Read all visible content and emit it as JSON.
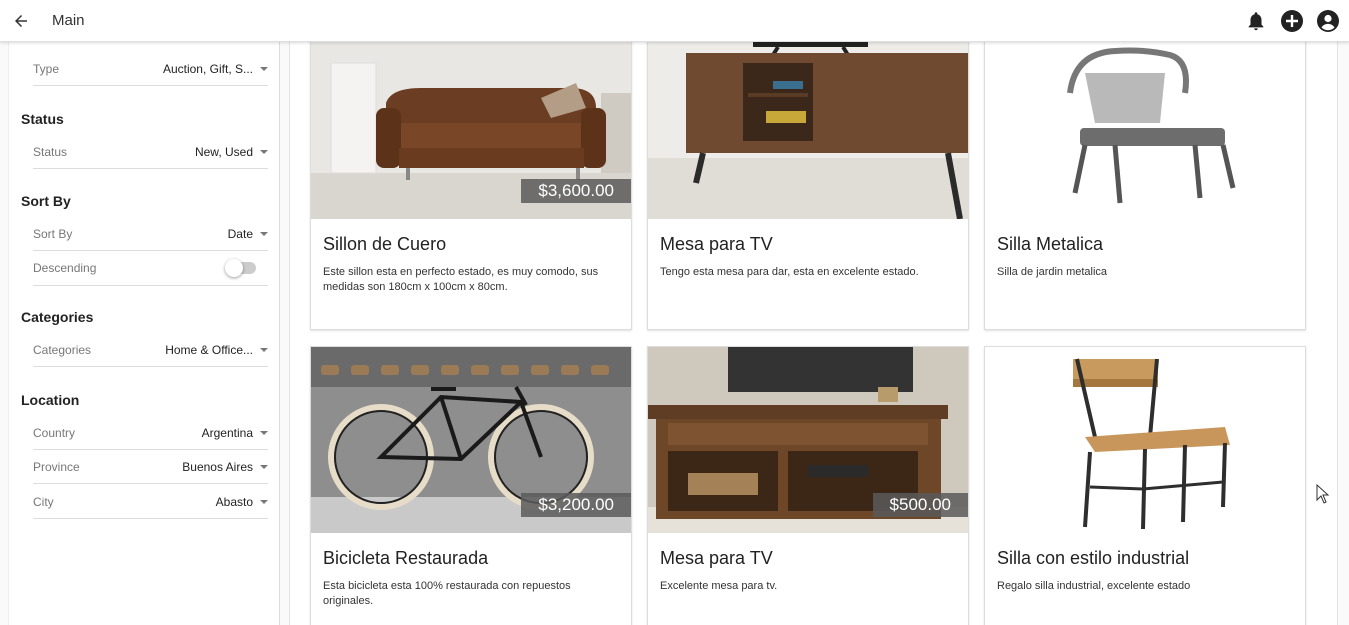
{
  "header": {
    "title": "Main",
    "icons": [
      "back-arrow-icon",
      "bell-icon",
      "add-circle-icon",
      "account-circle-icon"
    ]
  },
  "filters": {
    "type": {
      "label": "Type",
      "value": "Auction, Gift, S..."
    },
    "status": {
      "section": "Status",
      "label": "Status",
      "value": "New, Used"
    },
    "sort": {
      "section": "Sort By",
      "label": "Sort By",
      "value": "Date",
      "descending_label": "Descending",
      "descending": false
    },
    "categories": {
      "section": "Categories",
      "label": "Categories",
      "value": "Home & Office..."
    },
    "location": {
      "section": "Location",
      "country": {
        "label": "Country",
        "value": "Argentina"
      },
      "province": {
        "label": "Province",
        "value": "Buenos Aires"
      },
      "city": {
        "label": "City",
        "value": "Abasto"
      }
    }
  },
  "listings": [
    {
      "title": "Sillon de Cuero",
      "description": "Este sillon esta en perfecto estado, es muy comodo, sus medidas son 180cm x 100cm x 80cm.",
      "price": "$3,600.00",
      "image": "leather-sofa"
    },
    {
      "title": "Mesa para TV",
      "description": "Tengo esta mesa para dar, esta en excelente estado.",
      "price": "",
      "image": "wood-tv-stand"
    },
    {
      "title": "Silla Metalica",
      "description": "Silla de jardin metalica",
      "price": "",
      "image": "metal-chair"
    },
    {
      "title": "Bicicleta Restaurada",
      "description": "Esta bicicleta esta 100% restaurada con repuestos originales.",
      "price": "$3,200.00",
      "image": "bicycle"
    },
    {
      "title": "Mesa para TV",
      "description": "Excelente mesa para tv.",
      "price": "$500.00",
      "image": "rustic-tv-console"
    },
    {
      "title": "Silla con estilo industrial",
      "description": "Regalo silla industrial, excelente estado",
      "price": "",
      "image": "industrial-chair"
    }
  ],
  "colors": {
    "price_badge": "#5a5a5a",
    "appbar": "#ffffff"
  }
}
